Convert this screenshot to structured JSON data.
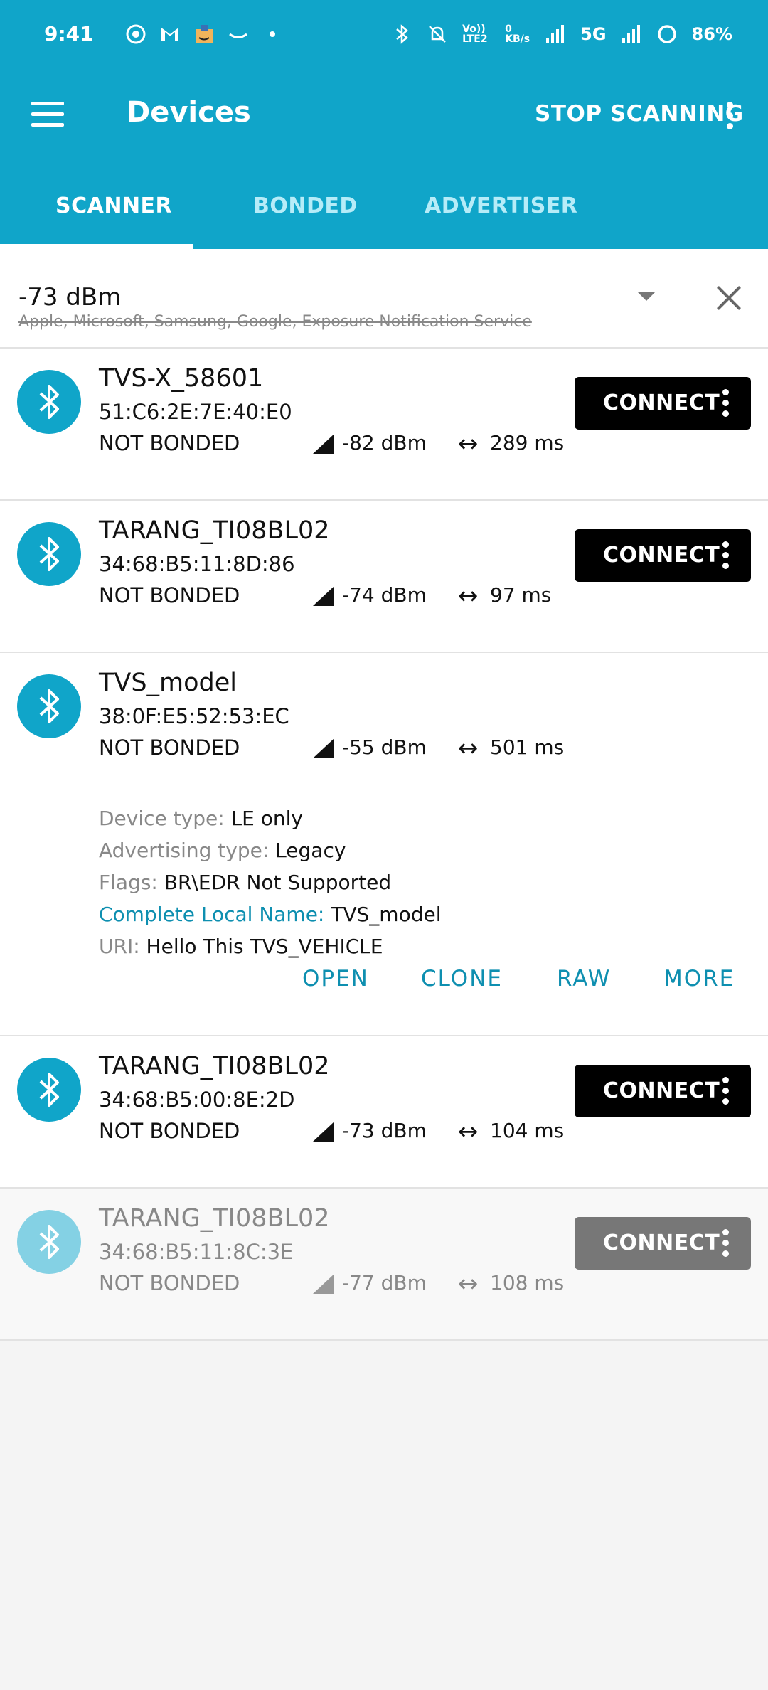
{
  "status_bar": {
    "time": "9:41",
    "battery": "86%",
    "network": "5G",
    "volte": "Vo)) LTE2",
    "speed": "0 KB/s",
    "icons": [
      "whatsapp-icon",
      "gmail-icon",
      "amazon-icon",
      "amazon-smile-icon",
      "dot-icon",
      "bluetooth-icon",
      "mute-icon",
      "signal-icon",
      "battery-icon"
    ]
  },
  "toolbar": {
    "title": "Devices",
    "stop_label": "STOP SCANNING"
  },
  "tabs": [
    {
      "label": "SCANNER",
      "active": true
    },
    {
      "label": "BONDED",
      "active": false
    },
    {
      "label": "ADVERTISER",
      "active": false
    }
  ],
  "filter": {
    "rssi": "-73 dBm",
    "excluded": "Apple, Microsoft, Samsung, Google, Exposure Notification Service"
  },
  "devices": [
    {
      "name": "TVS-X_58601",
      "mac": "51:C6:2E:7E:40:E0",
      "bond": "NOT BONDED",
      "rssi": "-82 dBm",
      "interval": "289 ms",
      "connect_label": "CONNECT",
      "expanded": false
    },
    {
      "name": "TARANG_TI08BL02",
      "mac": "34:68:B5:11:8D:86",
      "bond": "NOT BONDED",
      "rssi": "-74 dBm",
      "interval": "97 ms",
      "connect_label": "CONNECT",
      "expanded": false
    },
    {
      "name": "TVS_model",
      "mac": "38:0F:E5:52:53:EC",
      "bond": "NOT BONDED",
      "rssi": "-55 dBm",
      "interval": "501 ms",
      "expanded": true,
      "details": {
        "device_type_label": "Device type:",
        "device_type": "LE only",
        "adv_type_label": "Advertising type:",
        "adv_type": "Legacy",
        "flags_label": "Flags:",
        "flags": "BR\\EDR Not Supported",
        "local_name_label": "Complete Local Name:",
        "local_name": "TVS_model",
        "uri_label": "URI:",
        "uri": "Hello This TVS_VEHICLE"
      },
      "actions": {
        "open": "OPEN",
        "clone": "CLONE",
        "raw": "RAW",
        "more": "MORE"
      }
    },
    {
      "name": "TARANG_TI08BL02",
      "mac": "34:68:B5:00:8E:2D",
      "bond": "NOT BONDED",
      "rssi": "-73 dBm",
      "interval": "104 ms",
      "connect_label": "CONNECT",
      "expanded": false
    },
    {
      "name": "TARANG_TI08BL02",
      "mac": "34:68:B5:11:8C:3E",
      "bond": "NOT BONDED",
      "rssi": "-77 dBm",
      "interval": "108 ms",
      "connect_label": "CONNECT",
      "expanded": false,
      "faded": true
    }
  ],
  "colors": {
    "primary": "#10a5c9",
    "accent_text": "#0e8fb0",
    "connect_bg": "#000000"
  }
}
